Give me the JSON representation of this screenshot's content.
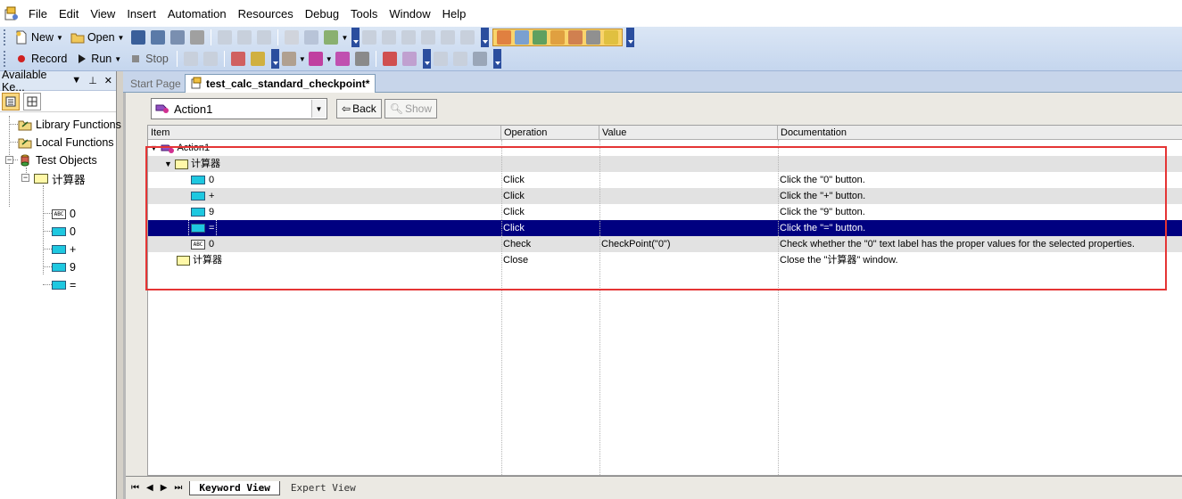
{
  "menu": {
    "items": [
      "File",
      "Edit",
      "View",
      "Insert",
      "Automation",
      "Resources",
      "Debug",
      "Tools",
      "Window",
      "Help"
    ]
  },
  "toolbar": {
    "new_label": "New",
    "open_label": "Open",
    "record_label": "Record",
    "run_label": "Run",
    "stop_label": "Stop"
  },
  "left_pane": {
    "title": "Available Ke...",
    "tree": {
      "library_functions": "Library Functions",
      "local_functions": "Local Functions",
      "test_objects": "Test Objects",
      "calculator": "计算器",
      "children": [
        "0",
        "0",
        "+",
        "9",
        "="
      ]
    }
  },
  "doc_tabs": {
    "start_page": "Start Page",
    "active": "test_calc_standard_checkpoint*"
  },
  "action_bar": {
    "selected_action": "Action1",
    "back_label": "Back",
    "show_label": "Show"
  },
  "grid": {
    "headers": [
      "Item",
      "Operation",
      "Value",
      "Documentation"
    ],
    "rows": [
      {
        "item": "Action1",
        "operation": "",
        "value": "",
        "documentation": ""
      },
      {
        "item": "计算器",
        "operation": "",
        "value": "",
        "documentation": ""
      },
      {
        "item": "0",
        "operation": "Click",
        "value": "",
        "documentation": "Click the \"0\" button."
      },
      {
        "item": "+",
        "operation": "Click",
        "value": "",
        "documentation": "Click the \"+\" button."
      },
      {
        "item": "9",
        "operation": "Click",
        "value": "",
        "documentation": "Click the \"9\" button."
      },
      {
        "item": "=",
        "operation": "Click",
        "value": "",
        "documentation": "Click the \"=\" button."
      },
      {
        "item": "0",
        "operation": "Check",
        "value": "CheckPoint(\"0\")",
        "documentation": "Check whether the \"0\" text label has the proper values for the selected properties."
      },
      {
        "item": "计算器",
        "operation": "Close",
        "value": "",
        "documentation": "Close the \"计算器\" window."
      }
    ]
  },
  "bottom_tabs": {
    "keyword_view": "Keyword View",
    "expert_view": "Expert View"
  },
  "colors": {
    "selection": "#000080",
    "highlight_box": "#e53535",
    "toolbar_bg": "#dbe6f5"
  }
}
